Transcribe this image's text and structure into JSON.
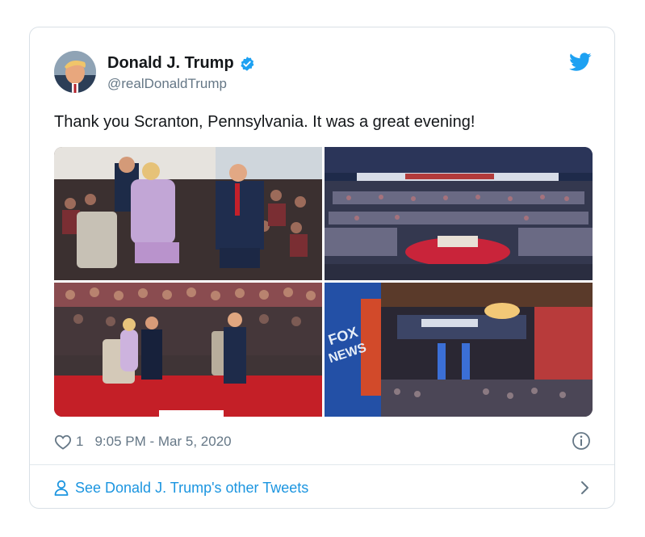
{
  "author": {
    "name": "Donald J. Trump",
    "handle": "@realDonaldTrump",
    "verified": true,
    "avatar_icon": "profile-photo"
  },
  "tweet": {
    "text": "Thank you Scranton, Pennsylvania. It was a great evening!",
    "photo_count": 4,
    "photos": [
      {
        "description_icon": "interview-photo-stage"
      },
      {
        "description_icon": "wide-arena-photo"
      },
      {
        "description_icon": "stage-red-carpet-photo"
      },
      {
        "description_icon": "fox-news-hall-photo"
      }
    ]
  },
  "meta": {
    "like_count": "1",
    "timestamp": "9:05 PM - Mar 5, 2020"
  },
  "footer": {
    "link_text": "See Donald J. Trump's other Tweets"
  },
  "colors": {
    "accent": "#1b95e0",
    "twitter_blue": "#1da1f2",
    "secondary_text": "#657786",
    "border": "#e1e8ed"
  }
}
